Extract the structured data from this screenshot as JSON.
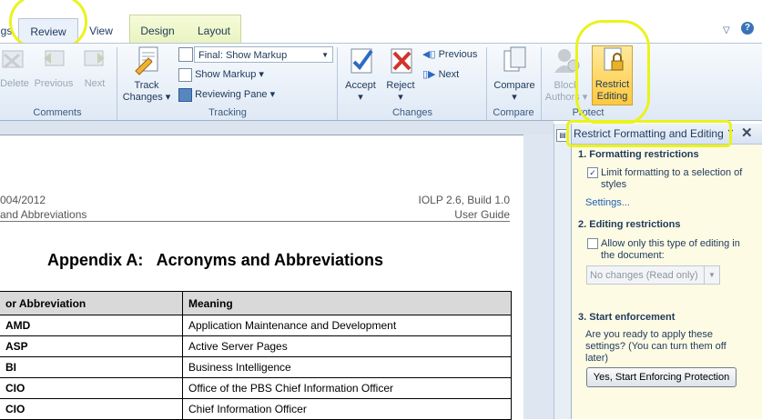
{
  "tabs": {
    "prev": "gs",
    "review": "Review",
    "view": "View",
    "design": "Design",
    "layout": "Layout"
  },
  "ribbon": {
    "comments": {
      "delete": "Delete",
      "previous": "Previous",
      "next": "Next",
      "label": "Comments"
    },
    "tracking": {
      "track_changes_1": "Track",
      "track_changes_2": "Changes",
      "markup_select": "Final: Show Markup",
      "show_markup": "Show Markup",
      "reviewing_pane": "Reviewing Pane",
      "label": "Tracking"
    },
    "changes": {
      "accept": "Accept",
      "reject": "Reject",
      "previous": "Previous",
      "next": "Next",
      "label": "Changes"
    },
    "compare": {
      "compare": "Compare",
      "label": "Compare"
    },
    "protect": {
      "block_1": "Block",
      "block_2": "Authors",
      "restrict_1": "Restrict",
      "restrict_2": "Editing",
      "label": "Protect"
    }
  },
  "document": {
    "header_left_1": "004/2012",
    "header_left_2": "and Abbreviations",
    "header_right_1": "IOLP 2.6, Build 1.0",
    "header_right_2": "User Guide",
    "title": "Appendix A:   Acronyms and Abbreviations",
    "col_acronym": " or Abbreviation",
    "col_meaning": "Meaning",
    "rows": [
      {
        "acr": "AMD",
        "meaning": "Application Maintenance and Development"
      },
      {
        "acr": "ASP",
        "meaning": "Active Server Pages"
      },
      {
        "acr": "BI",
        "meaning": "Business Intelligence"
      },
      {
        "acr": "CIO",
        "meaning": "Office of the PBS Chief Information Officer"
      },
      {
        "acr": "CIO",
        "meaning": "Chief Information Officer"
      }
    ]
  },
  "pane": {
    "title": "Restrict Formatting and Editing",
    "sec1": "1. Formatting restrictions",
    "limit_1": "Limit formatting to a selection of",
    "limit_2": "styles",
    "settings": "Settings...",
    "sec2": "2. Editing restrictions",
    "allow_1": "Allow only this type of editing in",
    "allow_2": "the document:",
    "no_changes": "No changes (Read only)",
    "sec3": "3. Start enforcement",
    "ready_1": "Are you ready to apply these",
    "ready_2": "settings? (You can turn them off",
    "ready_3": "later)",
    "enforce_button": "Yes, Start Enforcing Protection"
  }
}
